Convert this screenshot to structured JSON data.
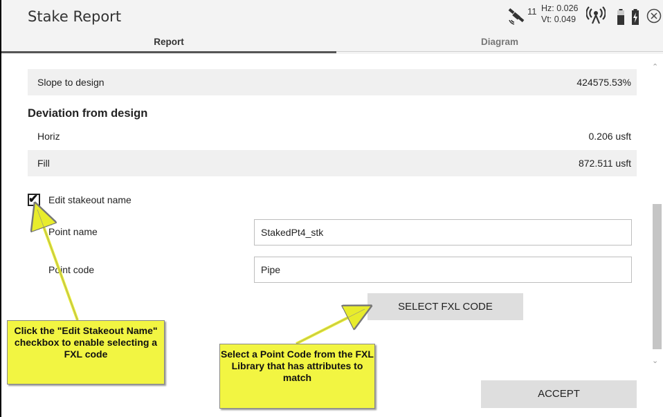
{
  "header": {
    "title": "Stake Report",
    "satellite_count": "11",
    "hz": "Hz: 0.026",
    "vt": "Vt: 0.049",
    "icons": [
      "satellite-icon",
      "radio-icon",
      "battery-icon",
      "battery-charging-icon",
      "close-icon"
    ]
  },
  "tabs": [
    {
      "label": "Report",
      "active": true
    },
    {
      "label": "Diagram",
      "active": false
    }
  ],
  "report": {
    "slope_label": "Slope to design",
    "slope_value": "424575.53%",
    "section_title": "Deviation from design",
    "horiz_label": "Horiz",
    "horiz_value": "0.206 usft",
    "fill_label": "Fill",
    "fill_value": "872.511 usft"
  },
  "stakeout": {
    "edit_name_label": "Edit stakeout name",
    "edit_name_checked": true,
    "point_name_label": "Point name",
    "point_name_value": "StakedPt4_stk",
    "point_code_label": "Point code",
    "point_code_value": "Pipe",
    "select_fxl_label": "SELECT FXL CODE",
    "accept_label": "ACCEPT"
  },
  "callouts": {
    "edit_stakeout": "Click the \"Edit Stakeout Name\" checkbox to enable selecting a FXL code",
    "fxl_library": "Select a Point Code from the FXL Library that has attributes to match"
  },
  "colors": {
    "callout_fill": "#f2f542",
    "header_bg": "#f3f3f3",
    "row_shade": "#f0f0f0",
    "button_bg": "#dedede"
  }
}
